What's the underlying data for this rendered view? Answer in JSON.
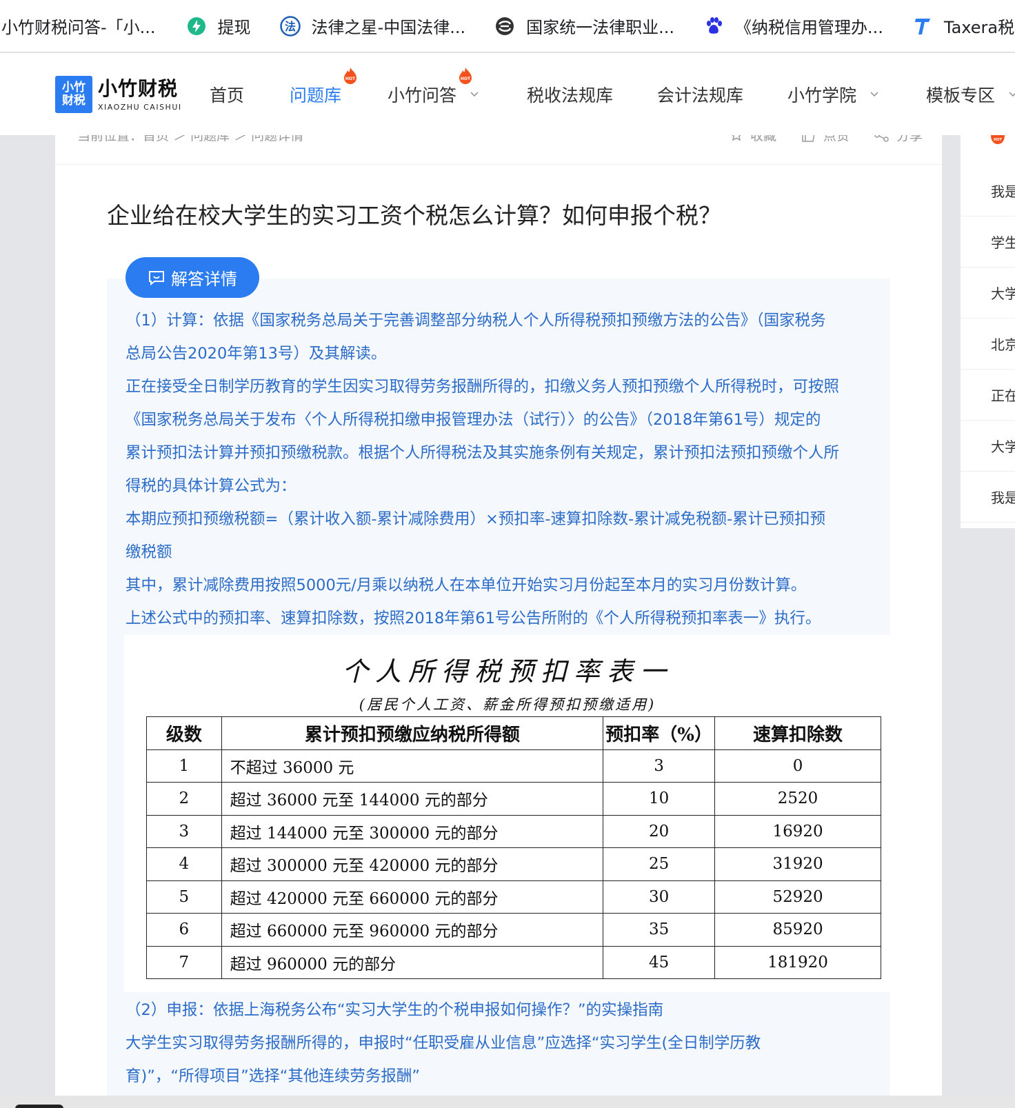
{
  "bookmarks": [
    {
      "label": "小竹财税问答-「小...",
      "icon": "none"
    },
    {
      "label": "提现",
      "icon": "lightning-icon",
      "color": "#1db98a"
    },
    {
      "label": "法律之星-中国法律...",
      "icon": "law-star-icon",
      "color": "#1a5fb4"
    },
    {
      "label": "国家统一法律职业...",
      "icon": "swirl-icon",
      "color": "#333333"
    },
    {
      "label": "《纳税信用管理办...",
      "icon": "baidu-paw-icon",
      "color": "#2b32e2"
    },
    {
      "label": "Taxera税纪",
      "icon": "taxera-t-icon",
      "color": "#2b7cf0"
    }
  ],
  "logo": {
    "box_line1": "小竹",
    "box_line2": "财税",
    "name": "小竹财税",
    "name_en": "XIAOZHU CAISHUI",
    "color": "#2b7cf0"
  },
  "nav": [
    {
      "label": "首页",
      "active": false,
      "hot": false,
      "dropdown": false
    },
    {
      "label": "问题库",
      "active": true,
      "hot": true,
      "dropdown": false
    },
    {
      "label": "小竹问答",
      "active": false,
      "hot": true,
      "dropdown": true
    },
    {
      "label": "税收法规库",
      "active": false,
      "hot": false,
      "dropdown": false
    },
    {
      "label": "会计法规库",
      "active": false,
      "hot": false,
      "dropdown": false
    },
    {
      "label": "小竹学院",
      "active": false,
      "hot": false,
      "dropdown": true
    },
    {
      "label": "模板专区",
      "active": false,
      "hot": false,
      "dropdown": true
    }
  ],
  "hot_badge": "HOT",
  "breadcrumb": "当前位置：首页 ＞ 问题库 ＞ 问题详情",
  "actions": {
    "favorite": "收藏",
    "like": "点赞",
    "share": "分享"
  },
  "question": {
    "title": "企业给在校大学生的实习工资个税怎么计算？如何申报个税？"
  },
  "answer": {
    "badge": "解答详情",
    "paragraphs_1": [
      "（1）计算：依据《国家税务总局关于完善调整部分纳税人个人所得税预扣预缴方法的公告》（国家税务",
      "总局公告2020年第13号）及其解读。",
      "正在接受全日制学历教育的学生因实习取得劳务报酬所得的，扣缴义务人预扣预缴个人所得税时，可按照",
      "《国家税务总局关于发布〈个人所得税扣缴申报管理办法（试行）〉的公告》（2018年第61号）规定的",
      "累计预扣法计算并预扣预缴税款。根据个人所得税法及其实施条例有关规定，累计预扣法预扣预缴个人所",
      "得税的具体计算公式为：",
      "本期应预扣预缴税额=（累计收入额-累计减除费用）×预扣率-速算扣除数-累计减免税额-累计已预扣预",
      "缴税额",
      "其中，累计减除费用按照5000元/月乘以纳税人在本单位开始实习月份起至本月的实习月份数计算。",
      "上述公式中的预扣率、速算扣除数，按照2018年第61号公告所附的《个人所得税预扣率表一》执行。"
    ],
    "paragraphs_2": [
      "（2）申报：依据上海税务公布“实习大学生的个税申报如何操作？”的实操指南",
      "大学生实习取得劳务报酬所得的，申报时“任职受雇从业信息”应选择“实习学生(全日制学历教",
      "育)”，“所得项目”选择“其他连续劳务报酬”"
    ],
    "color": "#2b6cc8"
  },
  "tax_table": {
    "title": "个人所得税预扣率表一",
    "subtitle": "(居民个人工资、薪金所得预扣预缴适用)",
    "headers": [
      "级数",
      "累计预扣预缴应纳税所得额",
      "预扣率（%）",
      "速算扣除数"
    ],
    "rows": [
      [
        "1",
        "不超过 36000 元",
        "3",
        "0"
      ],
      [
        "2",
        "超过 36000 元至 144000 元的部分",
        "10",
        "2520"
      ],
      [
        "3",
        "超过 144000 元至 300000 元的部分",
        "20",
        "16920"
      ],
      [
        "4",
        "超过 300000 元至 420000 元的部分",
        "25",
        "31920"
      ],
      [
        "5",
        "超过 420000 元至 660000 元的部分",
        "30",
        "52920"
      ],
      [
        "6",
        "超过 660000 元至 960000 元的部分",
        "35",
        "85920"
      ],
      [
        "7",
        "超过 960000 元的部分",
        "45",
        "181920"
      ]
    ]
  },
  "sidebar_items": [
    "我是",
    "学生",
    "大学",
    "北京",
    "正在",
    "大学",
    "我是"
  ]
}
